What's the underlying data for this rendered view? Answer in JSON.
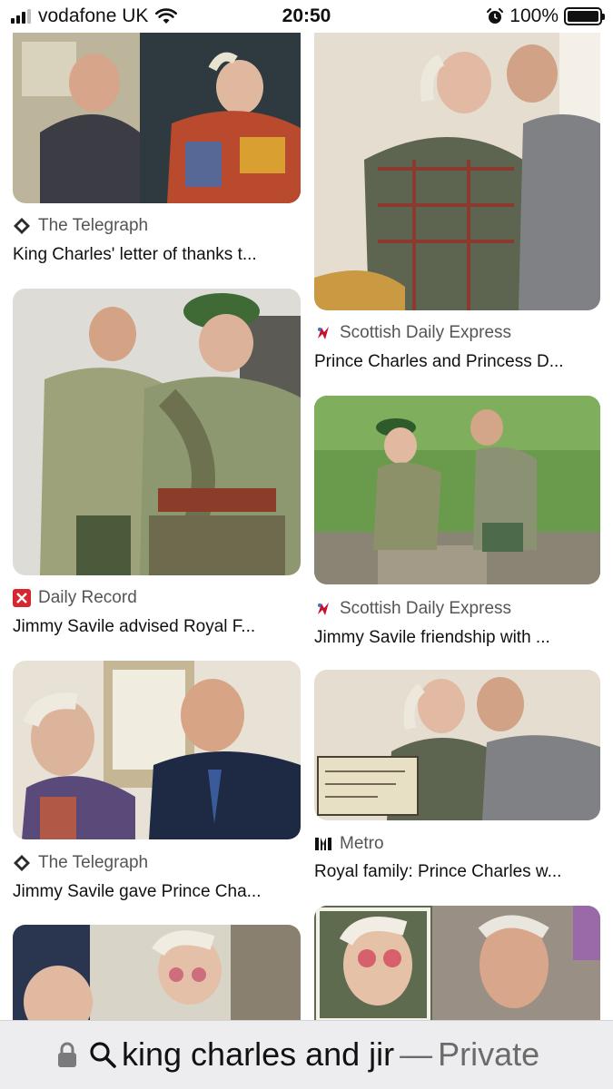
{
  "status_bar": {
    "carrier": "vodafone UK",
    "time": "20:50",
    "battery": "100%"
  },
  "results": [
    {
      "source": "The Telegraph",
      "source_icon": "telegraph-icon",
      "title": "King Charles' letter of thanks t..."
    },
    {
      "source": "Scottish Daily Express",
      "source_icon": "express-icon",
      "title": "Prince Charles and Princess D..."
    },
    {
      "source": "Daily Record",
      "source_icon": "daily-record-icon",
      "title": "Jimmy Savile advised Royal F..."
    },
    {
      "source": "Scottish Daily Express",
      "source_icon": "express-icon",
      "title": "Jimmy Savile friendship with ..."
    },
    {
      "source": "The Telegraph",
      "source_icon": "telegraph-icon",
      "title": "Jimmy Savile gave Prince Cha..."
    },
    {
      "source": "Metro",
      "source_icon": "metro-icon",
      "title": "Royal family: Prince Charles w..."
    }
  ],
  "search_bar": {
    "query": "king charles and jir",
    "separator": "—",
    "mode": "Private"
  },
  "colors": {
    "daily_record_red": "#d7262d",
    "express_red": "#c8102e",
    "muted_text": "#555555"
  }
}
